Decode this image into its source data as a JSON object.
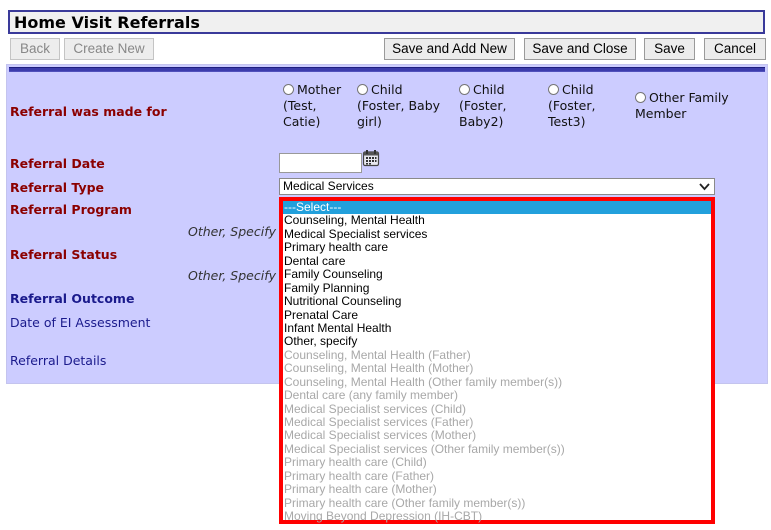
{
  "page": {
    "title": "Home Visit Referrals"
  },
  "toolbar": {
    "back_label": "Back",
    "create_new_label": "Create New",
    "save_and_add_new_label": "Save and Add New",
    "save_and_close_label": "Save and Close",
    "save_label": "Save",
    "cancel_label": "Cancel"
  },
  "form": {
    "referral_made_for": {
      "label": "Referral was made for",
      "options": [
        {
          "line1": "Mother",
          "line2": "(Test,",
          "line3": "Catie)",
          "checked": false
        },
        {
          "line1": "Child",
          "line2": "(Foster, Baby",
          "line3": "girl)",
          "checked": false
        },
        {
          "line1": "Child",
          "line2": "(Foster,",
          "line3": "Baby2)",
          "checked": false
        },
        {
          "line1": "Child",
          "line2": "(Foster,",
          "line3": "Test3)",
          "checked": false
        },
        {
          "line1": "Other Family",
          "line2": "Member",
          "line3": "",
          "checked": false
        }
      ]
    },
    "referral_date": {
      "label": "Referral Date",
      "value": "",
      "icon": "calendar-icon"
    },
    "referral_type": {
      "label": "Referral Type",
      "value": "Medical Services",
      "icon": "chevron-down-icon"
    },
    "referral_program": {
      "label": "Referral Program",
      "other_specify_label": "Other, Specify",
      "options": [
        {
          "label": "---Select---",
          "state": "selected"
        },
        {
          "label": "Counseling, Mental Health",
          "state": "enabled"
        },
        {
          "label": "Medical Specialist services",
          "state": "enabled"
        },
        {
          "label": "Primary health care",
          "state": "enabled"
        },
        {
          "label": "Dental care",
          "state": "enabled"
        },
        {
          "label": "Family Counseling",
          "state": "enabled"
        },
        {
          "label": "Family Planning",
          "state": "enabled"
        },
        {
          "label": "Nutritional Counseling",
          "state": "enabled"
        },
        {
          "label": "Prenatal Care",
          "state": "enabled"
        },
        {
          "label": "Infant Mental Health",
          "state": "enabled"
        },
        {
          "label": "Other, specify",
          "state": "enabled"
        },
        {
          "label": "Counseling, Mental Health (Father)",
          "state": "disabled"
        },
        {
          "label": "Counseling, Mental Health (Mother)",
          "state": "disabled"
        },
        {
          "label": "Counseling, Mental Health (Other family member(s))",
          "state": "disabled"
        },
        {
          "label": "Dental care (any family member)",
          "state": "disabled"
        },
        {
          "label": "Medical Specialist services (Child)",
          "state": "disabled"
        },
        {
          "label": "Medical Specialist services (Father)",
          "state": "disabled"
        },
        {
          "label": "Medical Specialist services (Mother)",
          "state": "disabled"
        },
        {
          "label": "Medical Specialist services (Other family member(s))",
          "state": "disabled"
        },
        {
          "label": "Primary health care (Child)",
          "state": "disabled"
        },
        {
          "label": "Primary health care (Father)",
          "state": "disabled"
        },
        {
          "label": "Primary health care (Mother)",
          "state": "disabled"
        },
        {
          "label": "Primary health care (Other family member(s))",
          "state": "disabled"
        },
        {
          "label": "Moving Beyond Depression (IH-CBT)",
          "state": "disabled"
        }
      ]
    },
    "referral_status": {
      "label": "Referral Status",
      "other_specify_label": "Other, Specify"
    },
    "referral_outcome": {
      "label": "Referral Outcome"
    },
    "date_of_ei_assessment": {
      "label": "Date of EI Assessment"
    },
    "referral_details": {
      "label": "Referral Details"
    }
  },
  "colors": {
    "panel_bg": "#ccccff",
    "required_label": "#8b0000",
    "optional_label": "#1a1a8c",
    "highlight_border": "#ff0000",
    "selected_option_bg": "#22a0dc"
  }
}
